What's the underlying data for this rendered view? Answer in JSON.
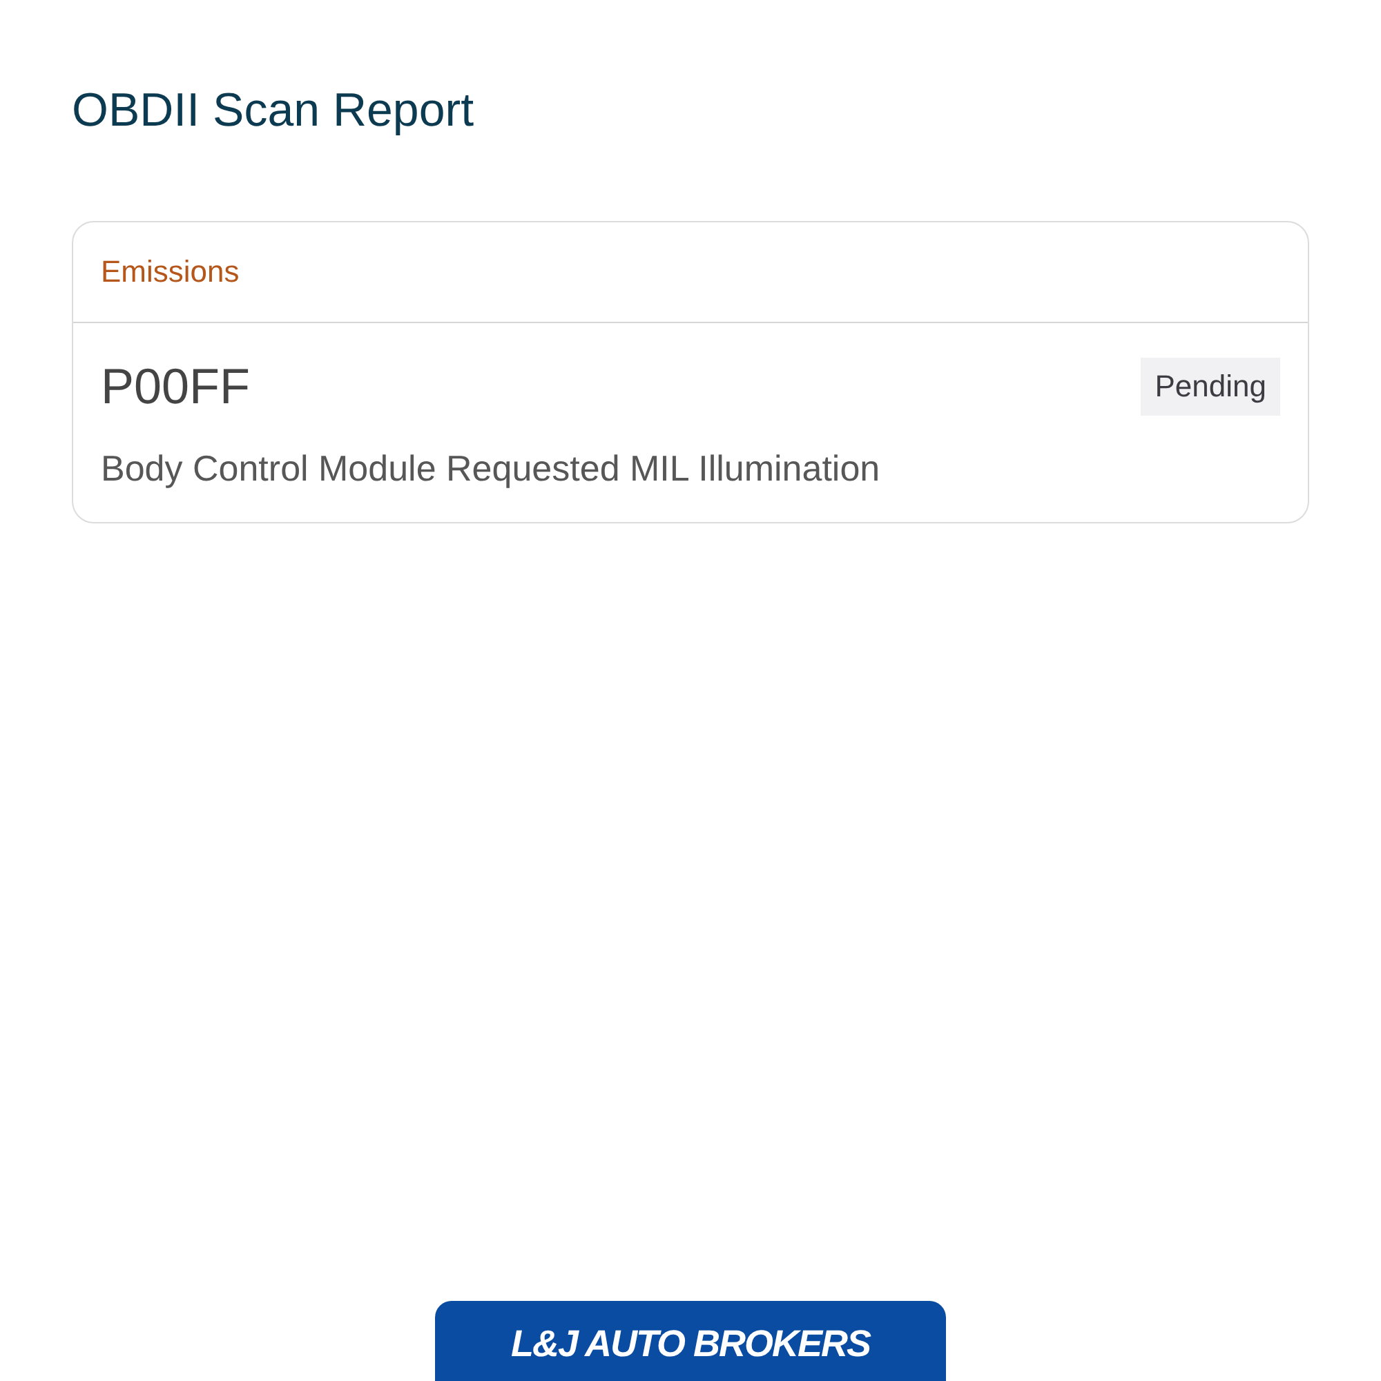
{
  "header": {
    "title": "OBDII Scan Report"
  },
  "card": {
    "category": "Emissions",
    "codes": [
      {
        "code": "P00FF",
        "status": "Pending",
        "description": "Body Control Module Requested MIL Illumination"
      }
    ]
  },
  "footer": {
    "logo_text": "L&J AUTO BROKERS"
  }
}
